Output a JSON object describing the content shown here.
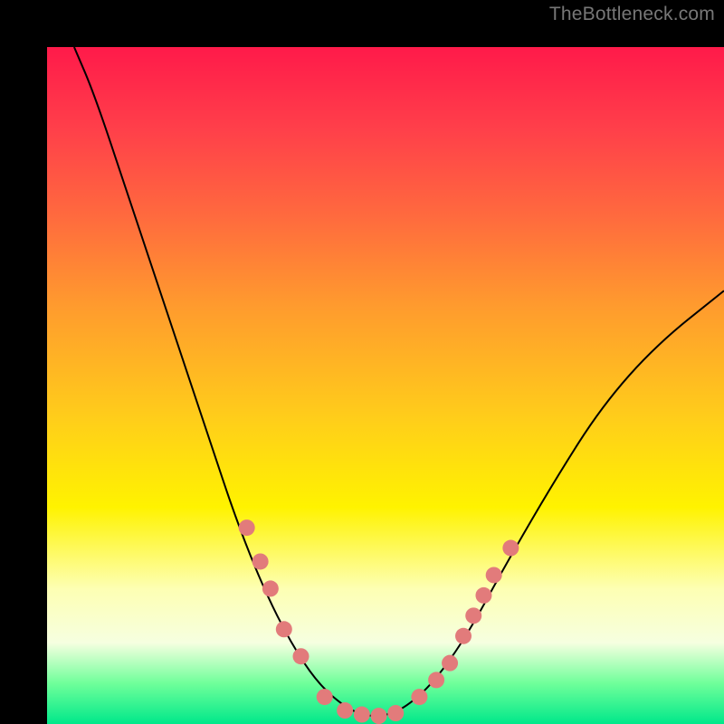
{
  "watermark": "TheBottleneck.com",
  "colors": {
    "dot_fill": "#e27b7b",
    "dot_stroke": "#c95a5a",
    "curve": "#000000"
  },
  "chart_data": {
    "type": "line",
    "title": "",
    "xlabel": "",
    "ylabel": "",
    "xlim": [
      0,
      100
    ],
    "ylim": [
      0,
      100
    ],
    "curve": [
      {
        "x": 4,
        "y": 100
      },
      {
        "x": 7,
        "y": 93
      },
      {
        "x": 12,
        "y": 78
      },
      {
        "x": 18,
        "y": 60
      },
      {
        "x": 24,
        "y": 42
      },
      {
        "x": 28,
        "y": 30
      },
      {
        "x": 32,
        "y": 20
      },
      {
        "x": 36,
        "y": 12
      },
      {
        "x": 40,
        "y": 6
      },
      {
        "x": 44,
        "y": 2.5
      },
      {
        "x": 47,
        "y": 1.2
      },
      {
        "x": 50,
        "y": 1.2
      },
      {
        "x": 53,
        "y": 2.5
      },
      {
        "x": 57,
        "y": 6
      },
      {
        "x": 62,
        "y": 13
      },
      {
        "x": 68,
        "y": 24
      },
      {
        "x": 75,
        "y": 36
      },
      {
        "x": 82,
        "y": 47
      },
      {
        "x": 90,
        "y": 56
      },
      {
        "x": 100,
        "y": 64
      }
    ],
    "dots": [
      {
        "x": 29.5,
        "y": 29
      },
      {
        "x": 31.5,
        "y": 24
      },
      {
        "x": 33.0,
        "y": 20
      },
      {
        "x": 35.0,
        "y": 14
      },
      {
        "x": 37.5,
        "y": 10
      },
      {
        "x": 41.0,
        "y": 4
      },
      {
        "x": 44.0,
        "y": 2
      },
      {
        "x": 46.5,
        "y": 1.4
      },
      {
        "x": 49.0,
        "y": 1.2
      },
      {
        "x": 51.5,
        "y": 1.6
      },
      {
        "x": 55.0,
        "y": 4
      },
      {
        "x": 57.5,
        "y": 6.5
      },
      {
        "x": 59.5,
        "y": 9
      },
      {
        "x": 61.5,
        "y": 13
      },
      {
        "x": 63.0,
        "y": 16
      },
      {
        "x": 64.5,
        "y": 19
      },
      {
        "x": 66.0,
        "y": 22
      },
      {
        "x": 68.5,
        "y": 26
      }
    ]
  }
}
